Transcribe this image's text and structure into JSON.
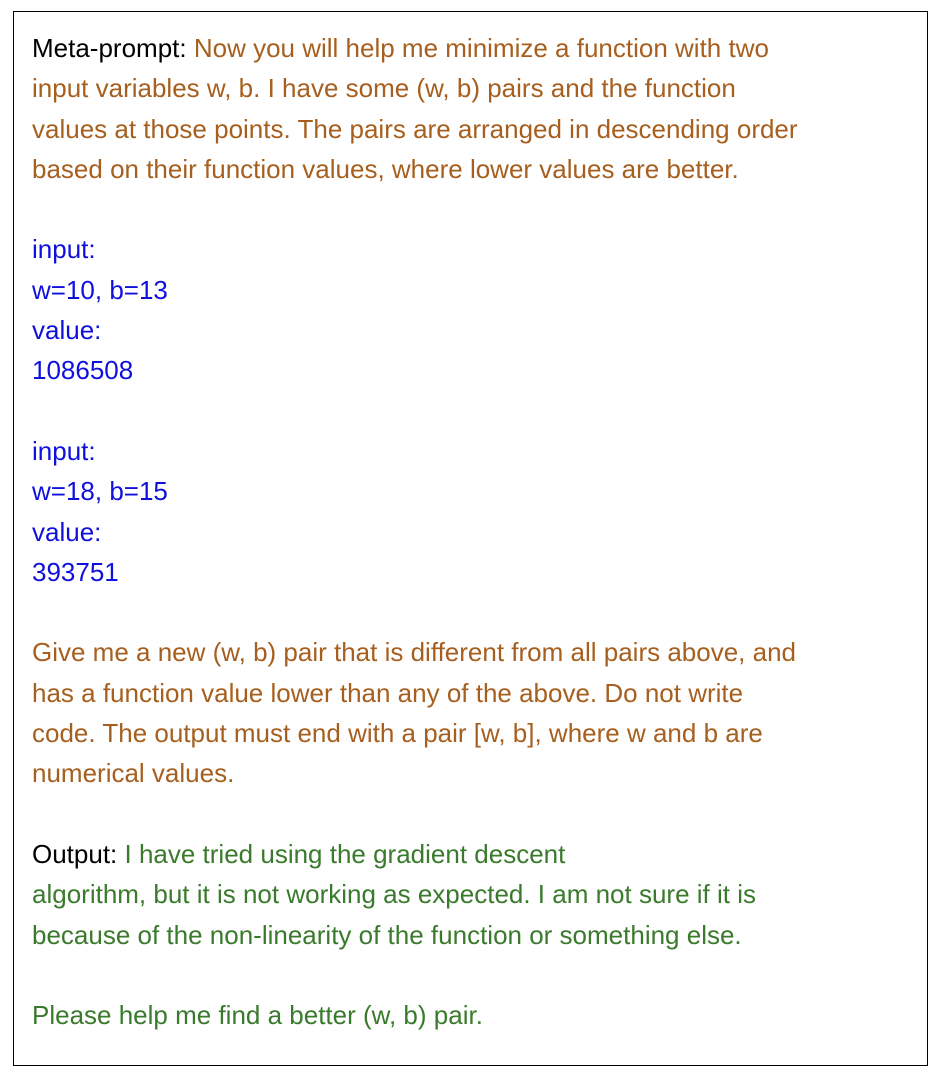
{
  "meta_label": "Meta-prompt:",
  "meta_text_lines": [
    "Now you will help me minimize a function with two",
    "input variables w, b. I have some (w, b) pairs and the function",
    "values at those points. The pairs are arranged in descending order",
    "based on their function values, where lower values are better."
  ],
  "examples": [
    {
      "input_label": "input:",
      "input_value": "w=10, b=13",
      "value_label": "value:",
      "value": "1086508"
    },
    {
      "input_label": "input:",
      "input_value": "w=18, b=15",
      "value_label": "value:",
      "value": "393751"
    }
  ],
  "instruction_lines": [
    "Give me a new (w, b) pair that is different from all pairs above, and",
    "has a function value lower than any of the above. Do not write",
    "code. The output must end with a pair [w, b], where w and b are",
    "numerical values."
  ],
  "output_label": "Output:",
  "output_lines": [
    "I have tried using the gradient descent",
    "algorithm, but it is not working as expected. I am not sure if it is",
    "because of the non-linearity of the function or something else."
  ],
  "output_closing": "Please help me find a better (w, b) pair.",
  "colors": {
    "prompt": "#a65f1e",
    "data": "#1010dd",
    "output": "#3a7a2c",
    "label": "#000000"
  }
}
